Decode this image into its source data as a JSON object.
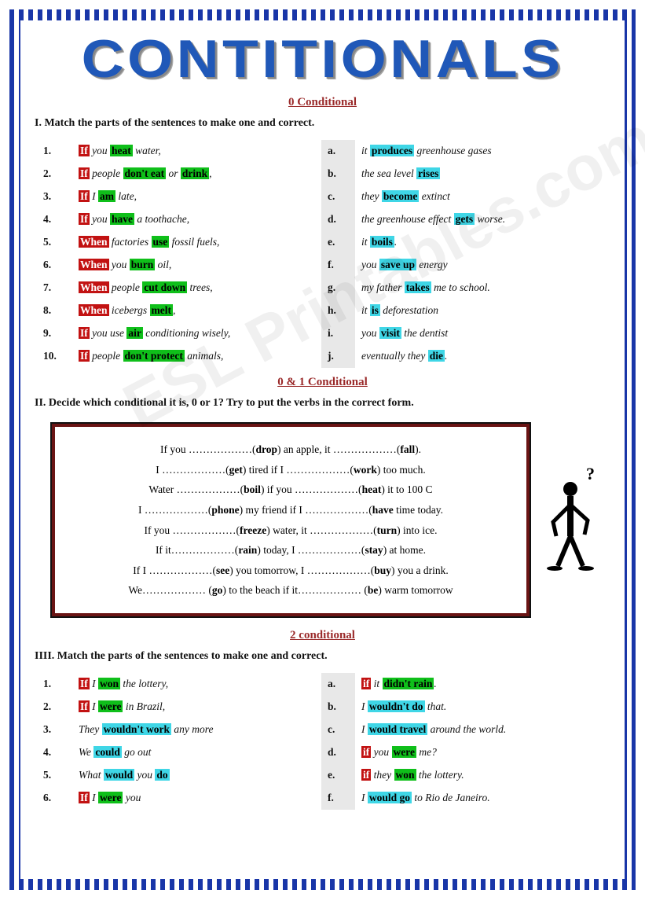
{
  "title": "CONTITIONALS",
  "watermark": "ESL Printables.com",
  "section1": {
    "heading": "0 Conditional",
    "instruction": "I. Match the parts of the sentences to make one and correct.",
    "left": [
      {
        "n": "1.",
        "parts": [
          {
            "t": "If",
            "c": "red"
          },
          {
            "t": " you "
          },
          {
            "t": "heat",
            "c": "grn"
          },
          {
            "t": " water,"
          }
        ]
      },
      {
        "n": "2.",
        "parts": [
          {
            "t": "If",
            "c": "red"
          },
          {
            "t": " people "
          },
          {
            "t": "don't eat",
            "c": "grn"
          },
          {
            "t": " or "
          },
          {
            "t": "drink",
            "c": "grn"
          },
          {
            "t": ","
          }
        ]
      },
      {
        "n": "3.",
        "parts": [
          {
            "t": "If",
            "c": "red"
          },
          {
            "t": " I "
          },
          {
            "t": "am",
            "c": "grn"
          },
          {
            "t": " late,"
          }
        ]
      },
      {
        "n": "4.",
        "parts": [
          {
            "t": "If",
            "c": "red"
          },
          {
            "t": " you "
          },
          {
            "t": "have",
            "c": "grn"
          },
          {
            "t": " a toothache,"
          }
        ]
      },
      {
        "n": "5.",
        "parts": [
          {
            "t": "When",
            "c": "red"
          },
          {
            "t": " factories "
          },
          {
            "t": "use",
            "c": "grn"
          },
          {
            "t": " fossil fuels,"
          }
        ]
      },
      {
        "n": "6.",
        "parts": [
          {
            "t": "When",
            "c": "red"
          },
          {
            "t": " you "
          },
          {
            "t": "burn",
            "c": "grn"
          },
          {
            "t": " oil,"
          }
        ]
      },
      {
        "n": "7.",
        "parts": [
          {
            "t": "When",
            "c": "red"
          },
          {
            "t": " people "
          },
          {
            "t": "cut down",
            "c": "grn"
          },
          {
            "t": " trees,"
          }
        ]
      },
      {
        "n": "8.",
        "parts": [
          {
            "t": "When",
            "c": "red"
          },
          {
            "t": " icebergs "
          },
          {
            "t": "melt",
            "c": "grn"
          },
          {
            "t": ","
          }
        ]
      },
      {
        "n": "9.",
        "parts": [
          {
            "t": "If",
            "c": "red"
          },
          {
            "t": " you use "
          },
          {
            "t": "air",
            "c": "grn"
          },
          {
            "t": " conditioning  wisely,"
          }
        ]
      },
      {
        "n": "10.",
        "parts": [
          {
            "t": "If",
            "c": "red"
          },
          {
            "t": " people "
          },
          {
            "t": "don't protect",
            "c": "grn"
          },
          {
            "t": " animals,"
          }
        ]
      }
    ],
    "right": [
      {
        "n": "a.",
        "parts": [
          {
            "t": "it "
          },
          {
            "t": "produces",
            "c": "cyn"
          },
          {
            "t": " greenhouse gases"
          }
        ]
      },
      {
        "n": "b.",
        "parts": [
          {
            "t": "the sea level "
          },
          {
            "t": "rises",
            "c": "cyn"
          }
        ]
      },
      {
        "n": "c.",
        "parts": [
          {
            "t": "they "
          },
          {
            "t": "become",
            "c": "cyn"
          },
          {
            "t": " extinct"
          }
        ]
      },
      {
        "n": "d.",
        "parts": [
          {
            "t": "the greenhouse effect "
          },
          {
            "t": "gets",
            "c": "cyn"
          },
          {
            "t": " worse."
          }
        ]
      },
      {
        "n": "e.",
        "parts": [
          {
            "t": "it "
          },
          {
            "t": "boils",
            "c": "cyn"
          },
          {
            "t": "."
          }
        ]
      },
      {
        "n": "f.",
        "parts": [
          {
            "t": "you "
          },
          {
            "t": "save up",
            "c": "cyn"
          },
          {
            "t": " energy"
          }
        ]
      },
      {
        "n": "g.",
        "parts": [
          {
            "t": "my father "
          },
          {
            "t": "takes",
            "c": "cyn"
          },
          {
            "t": " me to school."
          }
        ]
      },
      {
        "n": "h.",
        "parts": [
          {
            "t": "it "
          },
          {
            "t": "is",
            "c": "cyn"
          },
          {
            "t": " deforestation"
          }
        ]
      },
      {
        "n": "i.",
        "parts": [
          {
            "t": "you "
          },
          {
            "t": "visit",
            "c": "cyn"
          },
          {
            "t": " the dentist"
          }
        ]
      },
      {
        "n": "j.",
        "parts": [
          {
            "t": "eventually they "
          },
          {
            "t": "die",
            "c": "cyn"
          },
          {
            "t": "."
          }
        ]
      }
    ]
  },
  "section2": {
    "heading": "0 & 1 Conditional",
    "instruction": "II. Decide which conditional it is, 0 or 1? Try to put the verbs in the correct form.",
    "lines": [
      "If you ………………(<b>drop</b>) an apple, it ………………(<b>fall</b>).",
      "I ………………(<b>get</b>) tired if I ………………(<b>work</b>) too much.",
      "Water ………………(<b>boil</b>) if you ………………(<b>heat</b>) it to 100 C",
      "I ………………(<b>phone</b>) my friend if I ………………(<b>have</b> time today.",
      "If you ………………(<b>freeze</b>) water, it ………………(<b>turn</b>) into ice.",
      "If it………………(<b>rain</b>) today, I ………………(<b>stay</b>) at home.",
      "If I ………………(<b>see</b>) you tomorrow, I ………………(<b>buy</b>) you a drink.",
      "We……………… (<b>go</b>) to the beach if it……………… (<b>be</b>) warm tomorrow"
    ]
  },
  "section3": {
    "heading": "2 conditional",
    "instruction": "IIII. Match the parts of the sentences to make one and correct.",
    "left": [
      {
        "n": "1.",
        "parts": [
          {
            "t": "If",
            "c": "red"
          },
          {
            "t": " I "
          },
          {
            "t": "won",
            "c": "grn"
          },
          {
            "t": " the lottery,"
          }
        ]
      },
      {
        "n": "2.",
        "parts": [
          {
            "t": "If",
            "c": "red"
          },
          {
            "t": " I "
          },
          {
            "t": "were",
            "c": "grn"
          },
          {
            "t": " in Brazil,"
          }
        ]
      },
      {
        "n": "3.",
        "parts": [
          {
            "t": "They "
          },
          {
            "t": "wouldn't work",
            "c": "cyn"
          },
          {
            "t": " any more"
          }
        ]
      },
      {
        "n": "4.",
        "parts": [
          {
            "t": "We "
          },
          {
            "t": "could",
            "c": "cyn"
          },
          {
            "t": " go out"
          }
        ]
      },
      {
        "n": "5.",
        "parts": [
          {
            "t": "What "
          },
          {
            "t": "would",
            "c": "cyn"
          },
          {
            "t": " you "
          },
          {
            "t": "do",
            "c": "cyn"
          }
        ]
      },
      {
        "n": "6.",
        "parts": [
          {
            "t": "If",
            "c": "red"
          },
          {
            "t": " I "
          },
          {
            "t": "were",
            "c": "grn"
          },
          {
            "t": " you"
          }
        ]
      }
    ],
    "right": [
      {
        "n": "a.",
        "parts": [
          {
            "t": "if",
            "c": "red"
          },
          {
            "t": " it "
          },
          {
            "t": "didn't rain",
            "c": "grn"
          },
          {
            "t": "."
          }
        ]
      },
      {
        "n": "b.",
        "parts": [
          {
            "t": "I "
          },
          {
            "t": "wouldn't do",
            "c": "cyn"
          },
          {
            "t": " that."
          }
        ]
      },
      {
        "n": "c.",
        "parts": [
          {
            "t": "I "
          },
          {
            "t": "would travel",
            "c": "cyn"
          },
          {
            "t": " around the world."
          }
        ]
      },
      {
        "n": "d.",
        "parts": [
          {
            "t": "if",
            "c": "red"
          },
          {
            "t": " you "
          },
          {
            "t": "were",
            "c": "grn"
          },
          {
            "t": " me?"
          }
        ]
      },
      {
        "n": "e.",
        "parts": [
          {
            "t": "if",
            "c": "red"
          },
          {
            "t": " they "
          },
          {
            "t": "won",
            "c": "grn"
          },
          {
            "t": " the lottery."
          }
        ]
      },
      {
        "n": "f.",
        "parts": [
          {
            "t": "I "
          },
          {
            "t": "would go",
            "c": "cyn"
          },
          {
            "t": " to Rio de Janeiro."
          }
        ]
      }
    ]
  }
}
